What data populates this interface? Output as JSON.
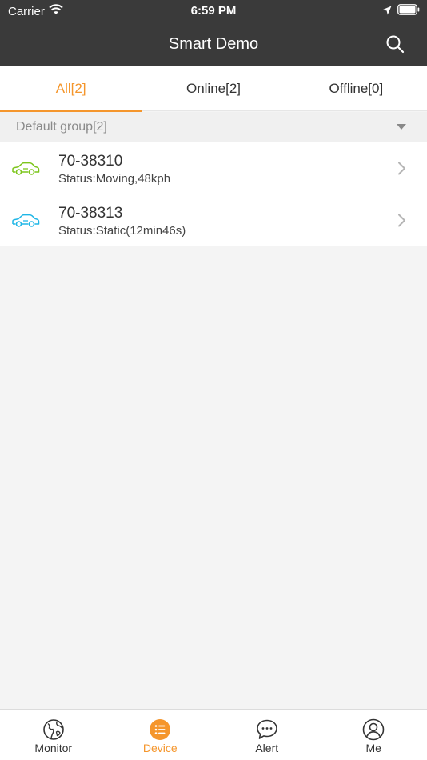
{
  "status_bar": {
    "carrier": "Carrier",
    "time": "6:59 PM"
  },
  "nav": {
    "title": "Smart Demo",
    "search_icon": "search-icon"
  },
  "tabs": [
    {
      "label": "All[2]",
      "active": true
    },
    {
      "label": "Online[2]",
      "active": false
    },
    {
      "label": "Offline[0]",
      "active": false
    }
  ],
  "group": {
    "label": "Default group[2]"
  },
  "devices": [
    {
      "name": "70-38310",
      "status": "Status:Moving,48kph",
      "icon": "car-icon",
      "color": "#7cc51b"
    },
    {
      "name": "70-38313",
      "status": "Status:Static(12min46s)",
      "icon": "car-icon",
      "color": "#1fb6e6"
    }
  ],
  "bottom_nav": [
    {
      "label": "Monitor",
      "icon": "globe-icon",
      "active": false
    },
    {
      "label": "Device",
      "icon": "list-icon",
      "active": true
    },
    {
      "label": "Alert",
      "icon": "chat-bubble-icon",
      "active": false
    },
    {
      "label": "Me",
      "icon": "user-icon",
      "active": false
    }
  ],
  "colors": {
    "accent": "#f5962c",
    "header_bg": "#3a3a3a",
    "moving": "#7cc51b",
    "static": "#1fb6e6"
  }
}
